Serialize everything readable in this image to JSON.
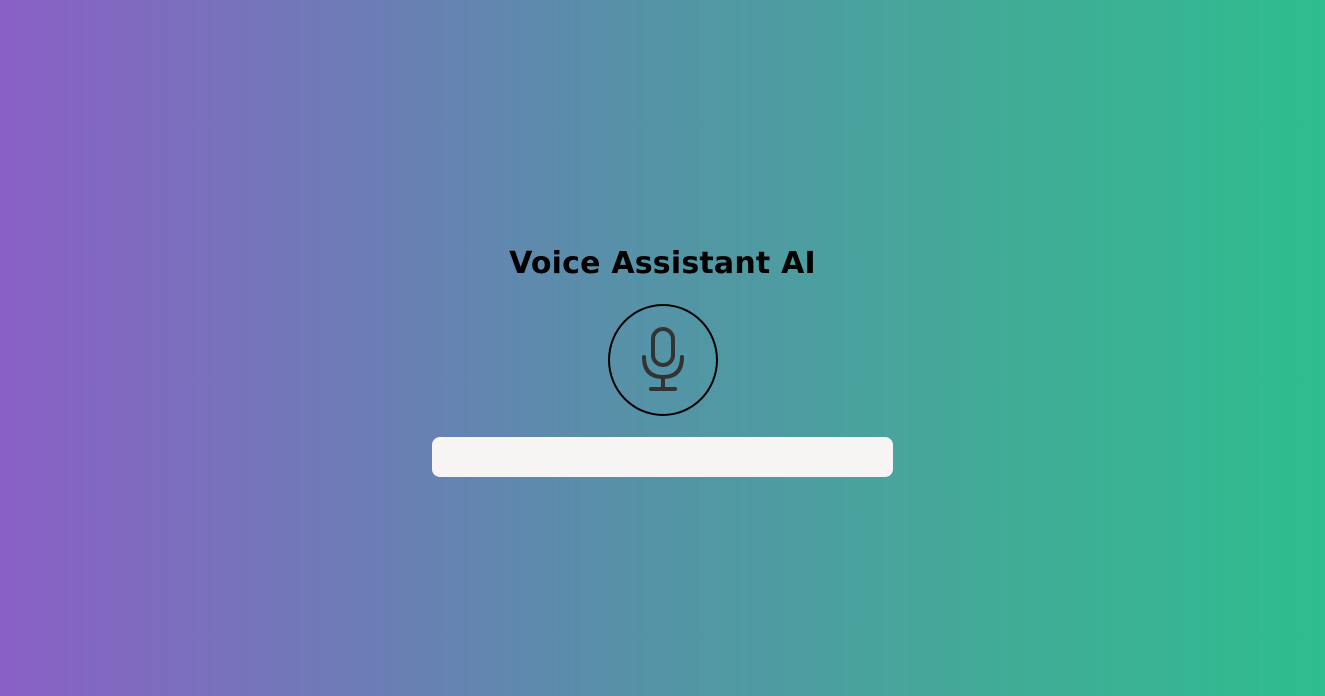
{
  "app": {
    "title": "Voice Assistant AI"
  },
  "mic_button": {
    "icon": "microphone-icon"
  },
  "transcript": {
    "value": "",
    "placeholder": ""
  },
  "colors": {
    "background_gradient_start": "#8a60c6",
    "background_gradient_end": "#2ebd8e",
    "title_text": "#000000",
    "icon": "#333333",
    "input_background": "#f7f5f4"
  }
}
